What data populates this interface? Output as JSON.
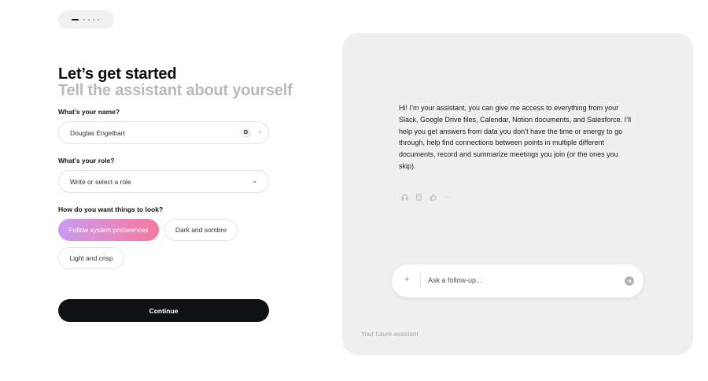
{
  "stepper": {
    "total": 5,
    "current": 1
  },
  "header": {
    "title": "Let’s get started",
    "subtitle": "Tell the assistant about yourself"
  },
  "name_field": {
    "label": "What’s your name?",
    "value": "Douglas Engelbart",
    "avatar_initial": "D"
  },
  "role_field": {
    "label": "What’s your role?",
    "placeholder": "Write or select a role"
  },
  "theme": {
    "label": "How do you want things to look?",
    "options": [
      "Follow system preferences",
      "Dark and sombre",
      "Light and crisp"
    ],
    "selected": "Follow system preferences"
  },
  "continue_label": "Continue",
  "preview": {
    "message": "Hi! I’m your assistant, you can give me access to everything from your Slack, Google Drive files, Calendar, Notion documents, and Salesforce. I’ll help you get answers from data you don’t have the time or energy to go through, help find connections between points in multiple different documents, record and summarize meetings you join (or the ones you skip).",
    "actions": [
      "headphones-icon",
      "copy-icon",
      "thumbs-up-icon",
      "more-icon"
    ],
    "composer_placeholder": "Ask a follow-up...",
    "footer": "Your future assistant"
  },
  "colors": {
    "accent_gradient_start": "#c79bf0",
    "accent_gradient_end": "#f27aa0",
    "continue_bg": "#0f1214",
    "panel_bg": "#f0f0f0"
  }
}
